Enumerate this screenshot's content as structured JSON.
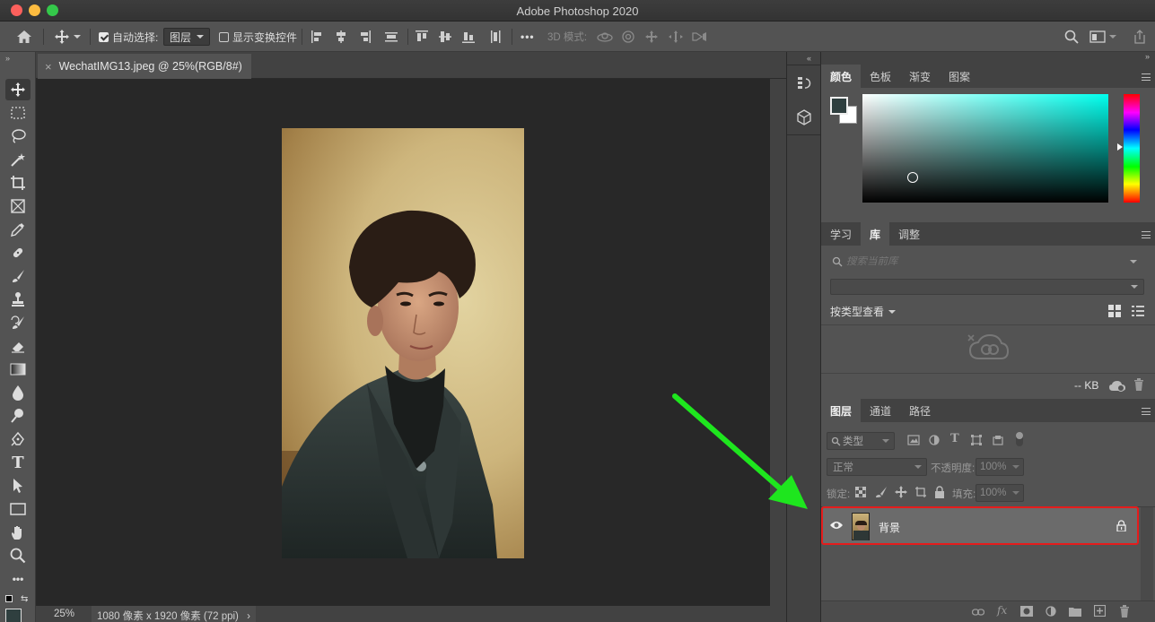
{
  "window": {
    "title": "Adobe Photoshop 2020",
    "traffic_colors": [
      "#fc605c",
      "#fdbc40",
      "#34c84a"
    ]
  },
  "options_bar": {
    "auto_select_label": "自动选择:",
    "auto_select_checked": true,
    "auto_select_target": "图层",
    "show_transform_label": "显示变换控件",
    "show_transform_checked": false,
    "more_label": "•••",
    "mode_3d_label": "3D 模式:"
  },
  "document": {
    "tab_title": "WechatIMG13.jpeg @ 25%(RGB/8#)",
    "zoom": "25%",
    "info": "1080 像素 x 1920 像素 (72 ppi)"
  },
  "color_panel": {
    "tabs": [
      "颜色",
      "色板",
      "渐变",
      "图案"
    ],
    "active_tab": "颜色",
    "hue_color": "#00ffee",
    "foreground": "#2f3f3f",
    "background": "#ffffff"
  },
  "library_panel": {
    "tabs": [
      "学习",
      "库",
      "调整"
    ],
    "active_tab": "库",
    "search_placeholder": "搜索当前库",
    "view_by_label": "按类型查看",
    "size_label": "-- KB"
  },
  "layers_panel": {
    "tabs": [
      "图层",
      "通道",
      "路径"
    ],
    "active_tab": "图层",
    "filter_label": "类型",
    "blend_mode": "正常",
    "opacity_label": "不透明度:",
    "opacity_value": "100%",
    "lock_label": "锁定:",
    "fill_label": "填充:",
    "fill_value": "100%",
    "layers": [
      {
        "name": "背景",
        "visible": true,
        "locked": true
      }
    ],
    "fx_label": "fx"
  },
  "annotation": {
    "arrow_color": "#1ee61e",
    "highlight_color": "#e51c1c"
  }
}
